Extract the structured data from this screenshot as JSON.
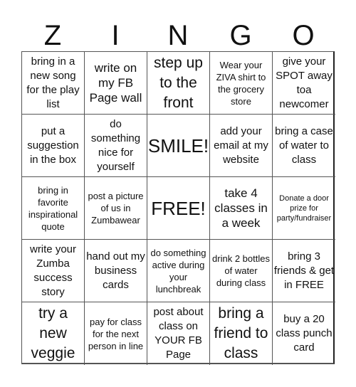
{
  "header": {
    "letters": [
      "Z",
      "I",
      "N",
      "G",
      "O"
    ]
  },
  "card": {
    "cells": [
      {
        "text": "bring in a new song for the play list",
        "style": "fs-m"
      },
      {
        "text": "write on my FB Page wall",
        "style": "fs-l"
      },
      {
        "text": "step up to the front",
        "style": "fs-xl"
      },
      {
        "text": "Wear your ZIVA shirt to the grocery store",
        "style": "fs-s"
      },
      {
        "text": "give your SPOT away toa newcomer",
        "style": "fs-m"
      },
      {
        "text": "put a suggestion in the box",
        "style": "fs-m"
      },
      {
        "text": "do something nice for yourself",
        "style": "fs-m"
      },
      {
        "text": "SMILE!",
        "style": "fs-free"
      },
      {
        "text": "add your email at my website",
        "style": "fs-m"
      },
      {
        "text": "bring a case of water to class",
        "style": "fs-m"
      },
      {
        "text": "bring in favorite inspirational quote",
        "style": "fs-s"
      },
      {
        "text": "post a picture of us in Zumbawear",
        "style": "fs-s"
      },
      {
        "text": "FREE!",
        "style": "fs-free"
      },
      {
        "text": "take 4 classes in a week",
        "style": "fs-l"
      },
      {
        "text": "Donate a door prize for party/fundraiser",
        "style": "fs-xs"
      },
      {
        "text": "write your Zumba success story",
        "style": "fs-m"
      },
      {
        "text": "hand out my business cards",
        "style": "fs-m"
      },
      {
        "text": "do something active during your lunchbreak",
        "style": "fs-s"
      },
      {
        "text": "drink 2 bottles of water during class",
        "style": "fs-s"
      },
      {
        "text": "bring 3 friends & get in FREE",
        "style": "fs-m"
      },
      {
        "text": "try a new veggie",
        "style": "fs-xl"
      },
      {
        "text": "pay for class for the next person in line",
        "style": "fs-s"
      },
      {
        "text": "post about class on YOUR FB Page",
        "style": "fs-m"
      },
      {
        "text": "bring a friend to class",
        "style": "fs-xl"
      },
      {
        "text": "buy a 20 class punch card",
        "style": "fs-m"
      }
    ]
  }
}
